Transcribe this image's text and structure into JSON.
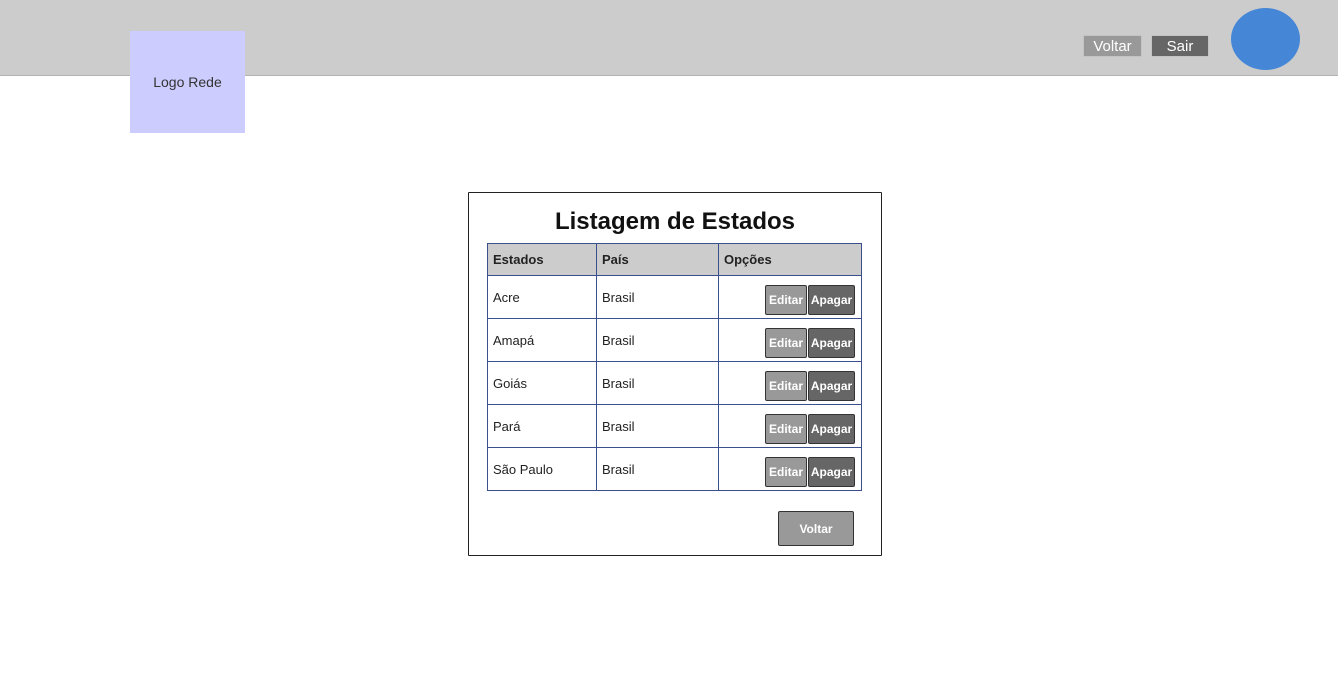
{
  "header": {
    "logo_label": "Logo Rede",
    "back_label": "Voltar",
    "exit_label": "Sair"
  },
  "main": {
    "title": "Listagem de Estados",
    "columns": [
      "Estados",
      "País",
      "Opções"
    ],
    "rows": [
      {
        "estado": "Acre",
        "pais": "Brasil",
        "edit_label": "Editar",
        "delete_label": "Apagar"
      },
      {
        "estado": "Amapá",
        "pais": "Brasil",
        "edit_label": "Editar",
        "delete_label": "Apagar"
      },
      {
        "estado": "Goiás",
        "pais": "Brasil",
        "edit_label": "Editar",
        "delete_label": "Apagar"
      },
      {
        "estado": "Pará",
        "pais": "Brasil",
        "edit_label": "Editar",
        "delete_label": "Apagar"
      },
      {
        "estado": "São Paulo",
        "pais": "Brasil",
        "edit_label": "Editar",
        "delete_label": "Apagar"
      }
    ],
    "back_label": "Voltar"
  },
  "colors": {
    "header_bg": "#cccccc",
    "logo_bg": "#ccccff",
    "avatar": "#4587d6",
    "button_light": "#999999",
    "button_dark": "#666666",
    "table_border": "#3a4f8c"
  }
}
